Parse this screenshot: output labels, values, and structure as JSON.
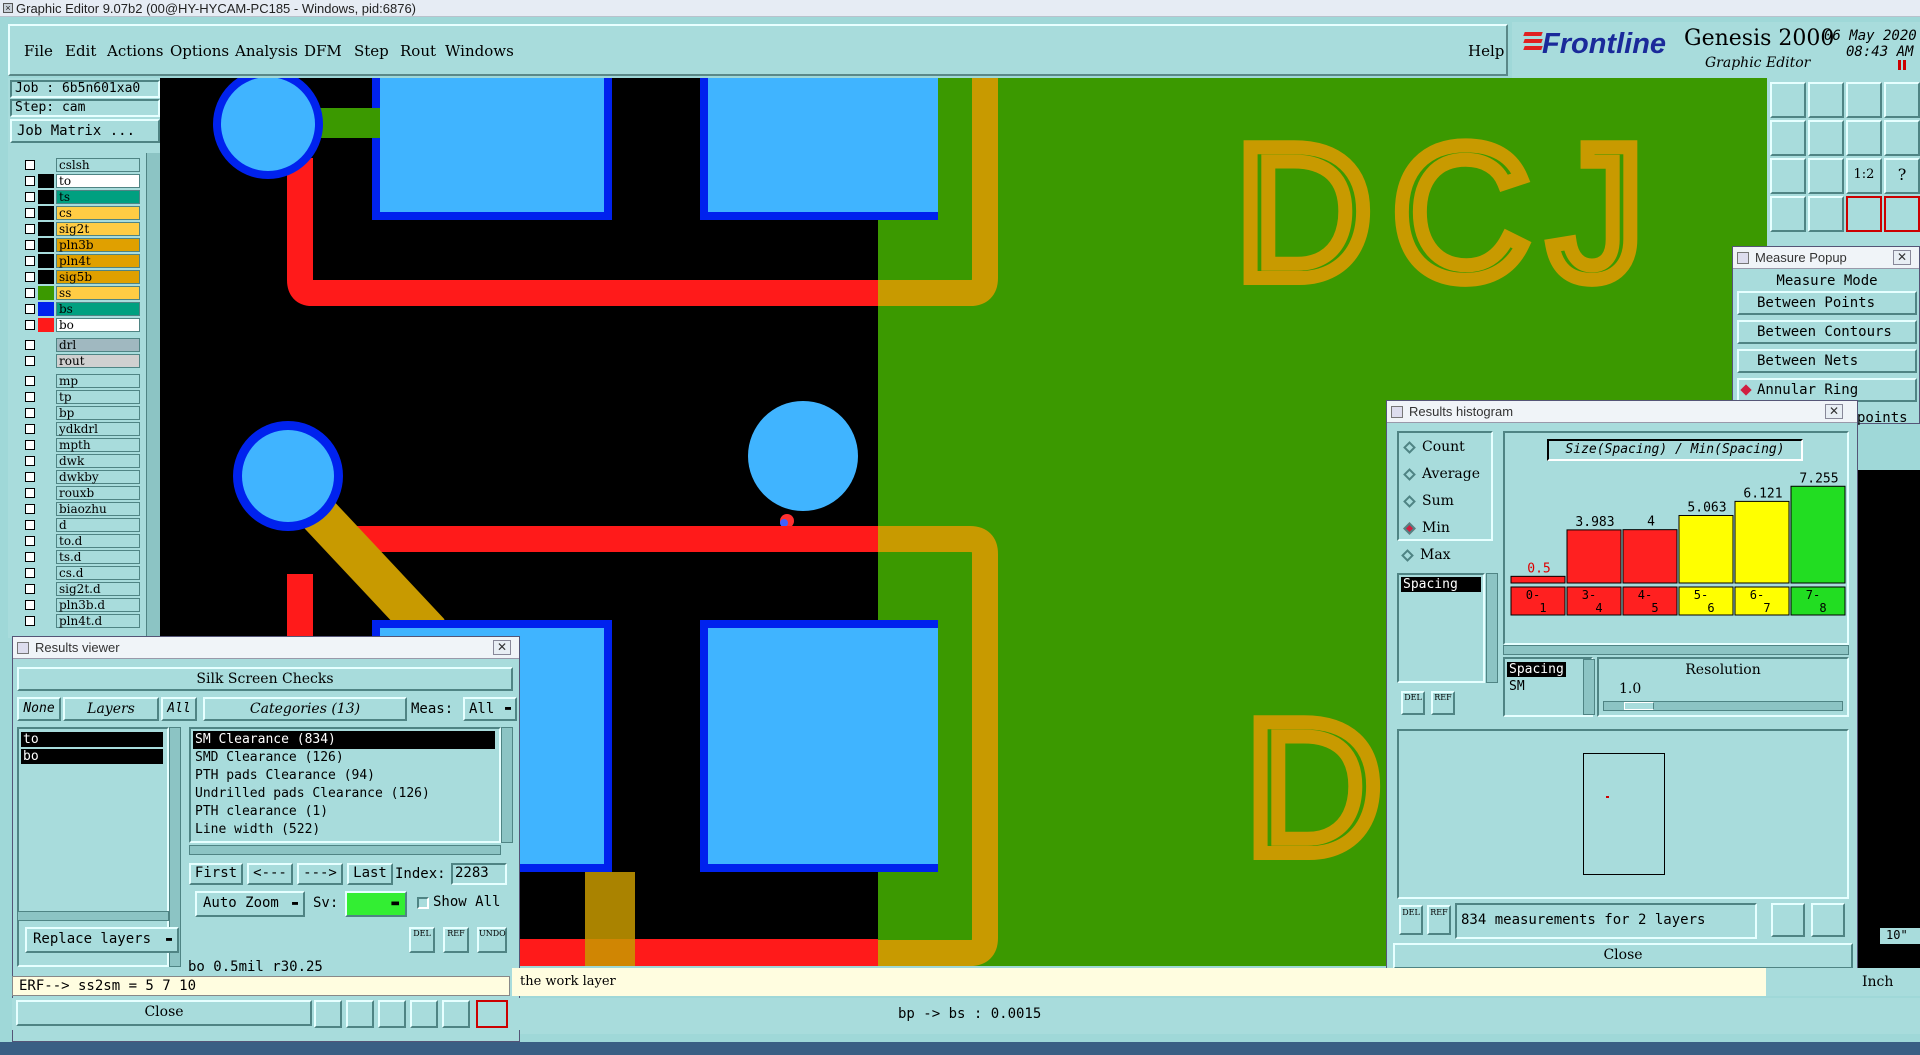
{
  "window": {
    "title": "Graphic Editor 9.07b2 (00@HY-HYCAM-PC185 - Windows, pid:6876)"
  },
  "menu": {
    "items": [
      "File",
      "Edit",
      "Actions",
      "Options",
      "Analysis",
      "DFM",
      "Step",
      "Rout",
      "Windows"
    ],
    "help": "Help"
  },
  "brand": {
    "logo": "Frontline",
    "product": "Genesis 2000",
    "subtitle": "Graphic Editor",
    "date": "06 May 2020",
    "time": "08:43 AM"
  },
  "job": {
    "job_label": "Job : 6b5n601xa0",
    "step_label": "Step: cam",
    "matrix_button": "Job Matrix ..."
  },
  "layers": {
    "items": [
      {
        "name": "cslsh",
        "color": "#a8dcdc"
      },
      {
        "name": "to",
        "color": "#ffffff"
      },
      {
        "name": "ts",
        "color": "#00a080"
      },
      {
        "name": "cs",
        "color": "#ffcc44"
      },
      {
        "name": "sig2t",
        "color": "#ffcc44"
      },
      {
        "name": "pln3b",
        "color": "#e0a000"
      },
      {
        "name": "pln4t",
        "color": "#e0a000"
      },
      {
        "name": "sig5b",
        "color": "#e0a000"
      },
      {
        "name": "ss",
        "color": "#ffcc44"
      },
      {
        "name": "bs",
        "color": "#00a080"
      },
      {
        "name": "bo",
        "color": "#ffffff"
      }
    ],
    "items2": [
      {
        "name": "drl",
        "color": "#a0b8c0"
      },
      {
        "name": "rout",
        "color": "#d0d0d0"
      }
    ],
    "items3": [
      "mp",
      "tp",
      "bp",
      "ydkdrl",
      "mpth",
      "dwk",
      "dwkby",
      "rouxb",
      "biaozhu",
      "d",
      "to.d",
      "ts.d",
      "cs.d",
      "sig2t.d",
      "pln3b.d",
      "pln4t.d"
    ]
  },
  "canvas": {
    "silk_text_1": "DCJ",
    "silk_text_2": "D",
    "work_layer_msg": "the work layer"
  },
  "results_viewer": {
    "title": "Results viewer",
    "header": "Silk Screen Checks",
    "none_btn": "None",
    "layers_btn": "Layers",
    "all_btn": "All",
    "categories_btn": "Categories (13)",
    "meas_label": "Meas:",
    "meas_value": "All",
    "layer_list": [
      "to",
      "bo"
    ],
    "categories": [
      "SM Clearance (834)",
      "SMD Clearance (126)",
      "PTH pads Clearance (94)",
      "Undrilled pads Clearance (126)",
      "PTH clearance (1)",
      "Line width (522)"
    ],
    "first": "First",
    "prev": "<---",
    "next": "--->",
    "last": "Last",
    "index_label": "Index:",
    "index_value": "2283",
    "auto_zoom": "Auto Zoom",
    "sv_label": "Sv:",
    "show_all": "Show All",
    "replace_layers": "Replace layers",
    "info_line": "bo 0.5mil  r30.25",
    "erf_line": "ERF--> ss2sm = 5 7 10",
    "close": "Close",
    "del": "DEL",
    "ref": "REF",
    "undo": "UNDO"
  },
  "measure_popup": {
    "title": "Measure Popup",
    "mode_header": "Measure Mode",
    "modes": [
      "Between Points",
      "Between Contours",
      "Between Nets",
      "Annular Ring"
    ],
    "partial": "points"
  },
  "histogram": {
    "title": "Results histogram",
    "options": [
      "Count",
      "Average",
      "Sum",
      "Min",
      "Max"
    ],
    "selected": "Min",
    "list_item": "Spacing",
    "chart_title": "Size(Spacing) / Min(Spacing)",
    "spacing_label": "Spacing",
    "sm_label": "SM",
    "resolution_label": "Resolution",
    "resolution_value": "1.0",
    "status": "834 measurements for 2 layers",
    "close": "Close",
    "del": "DEL",
    "ref": "REF"
  },
  "chart_data": {
    "type": "bar",
    "title": "Size(Spacing) / Min(Spacing)",
    "categories": [
      "0-1",
      "3-4",
      "4-5",
      "5-6",
      "6-7",
      "7-8"
    ],
    "values": [
      0.5,
      3.983,
      4,
      5.063,
      6.121,
      7.255
    ],
    "value_labels": [
      "0.5",
      "3.983",
      "4",
      "5.063",
      "6.121",
      "7.255"
    ],
    "bar_colors": [
      "#ff2020",
      "#ff2020",
      "#ff2020",
      "#ffff00",
      "#ffff00",
      "#22dd22"
    ],
    "xlabel": "",
    "ylabel": "",
    "ylim": [
      0,
      7.5
    ]
  },
  "status_bar": {
    "center_text": "bp -> bs : 0.0015",
    "units": "Inch",
    "partial_value": "10\""
  },
  "colors": {
    "panel": "#a8dcdc",
    "copper": "#c89a00",
    "plane": "#3b9900",
    "trace": "#ff1a1a",
    "pad": "#40b4ff",
    "pad_outline": "#0022ee"
  }
}
